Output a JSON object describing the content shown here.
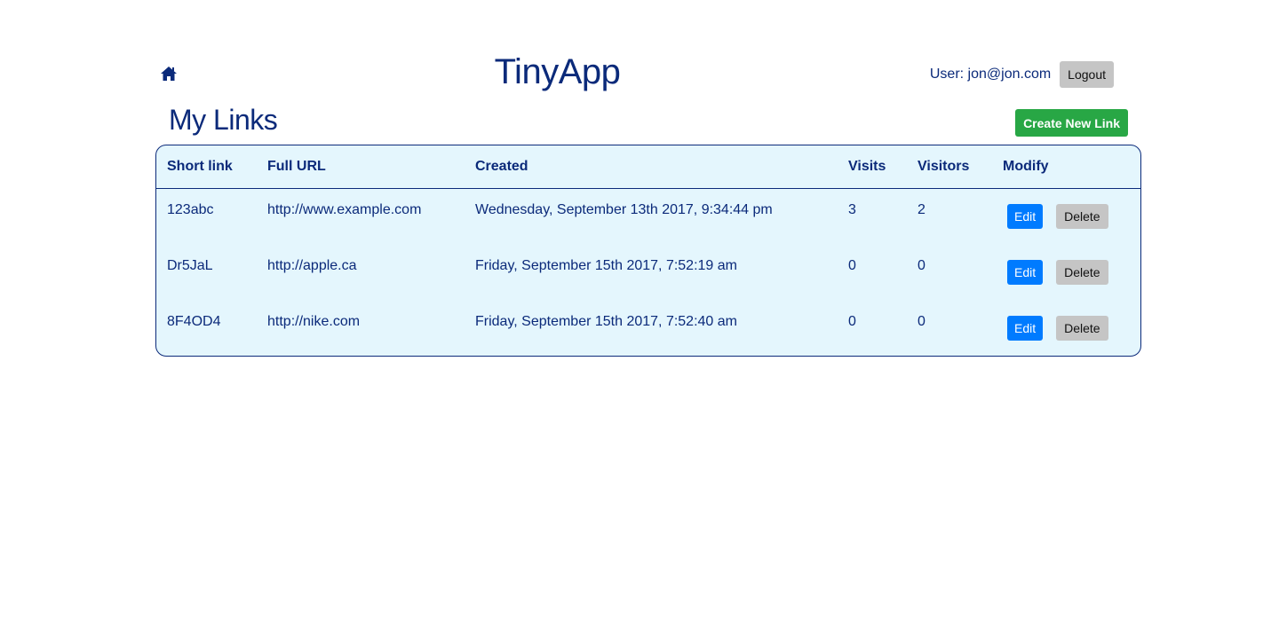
{
  "header": {
    "home_icon": "home-icon",
    "app_title": "TinyApp",
    "user_label": "User: jon@jon.com",
    "logout_label": "Logout"
  },
  "main": {
    "section_title": "My Links",
    "create_label": "Create New Link"
  },
  "table": {
    "columns": [
      "Short link",
      "Full URL",
      "Created",
      "Visits",
      "Visitors",
      "Modify"
    ],
    "rows": [
      {
        "short": "123abc",
        "url": "http://www.example.com",
        "created": "Wednesday, September 13th 2017, 9:34:44 pm",
        "visits": "3",
        "visitors": "2",
        "edit_label": "Edit",
        "delete_label": "Delete"
      },
      {
        "short": "Dr5JaL",
        "url": "http://apple.ca",
        "created": "Friday, September 15th 2017, 7:52:19 am",
        "visits": "0",
        "visitors": "0",
        "edit_label": "Edit",
        "delete_label": "Delete"
      },
      {
        "short": "8F4OD4",
        "url": "http://nike.com",
        "created": "Friday, September 15th 2017, 7:52:40 am",
        "visits": "0",
        "visitors": "0",
        "edit_label": "Edit",
        "delete_label": "Delete"
      }
    ]
  },
  "colors": {
    "primary_text": "#0b2a7a",
    "table_bg": "#e4f6fd",
    "create_button": "#28a745",
    "edit_button": "#007bff",
    "neutral_button": "#c5c5c5"
  }
}
